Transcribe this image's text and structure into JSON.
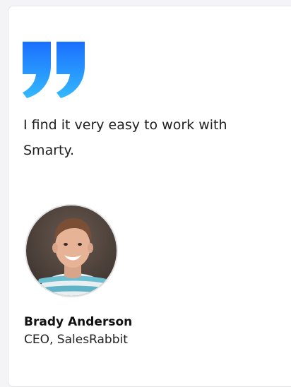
{
  "testimonial": {
    "quote_icon": "quote-mark-icon",
    "quote": "I find it very easy to work with Smarty.",
    "author": {
      "name": "Brady Anderson",
      "title": "CEO, SalesRabbit",
      "avatar": "avatar-photo"
    }
  },
  "colors": {
    "quote_gradient_top": "#1e7bff",
    "quote_gradient_bottom": "#2fb4ff",
    "text": "#1f1f1f"
  }
}
